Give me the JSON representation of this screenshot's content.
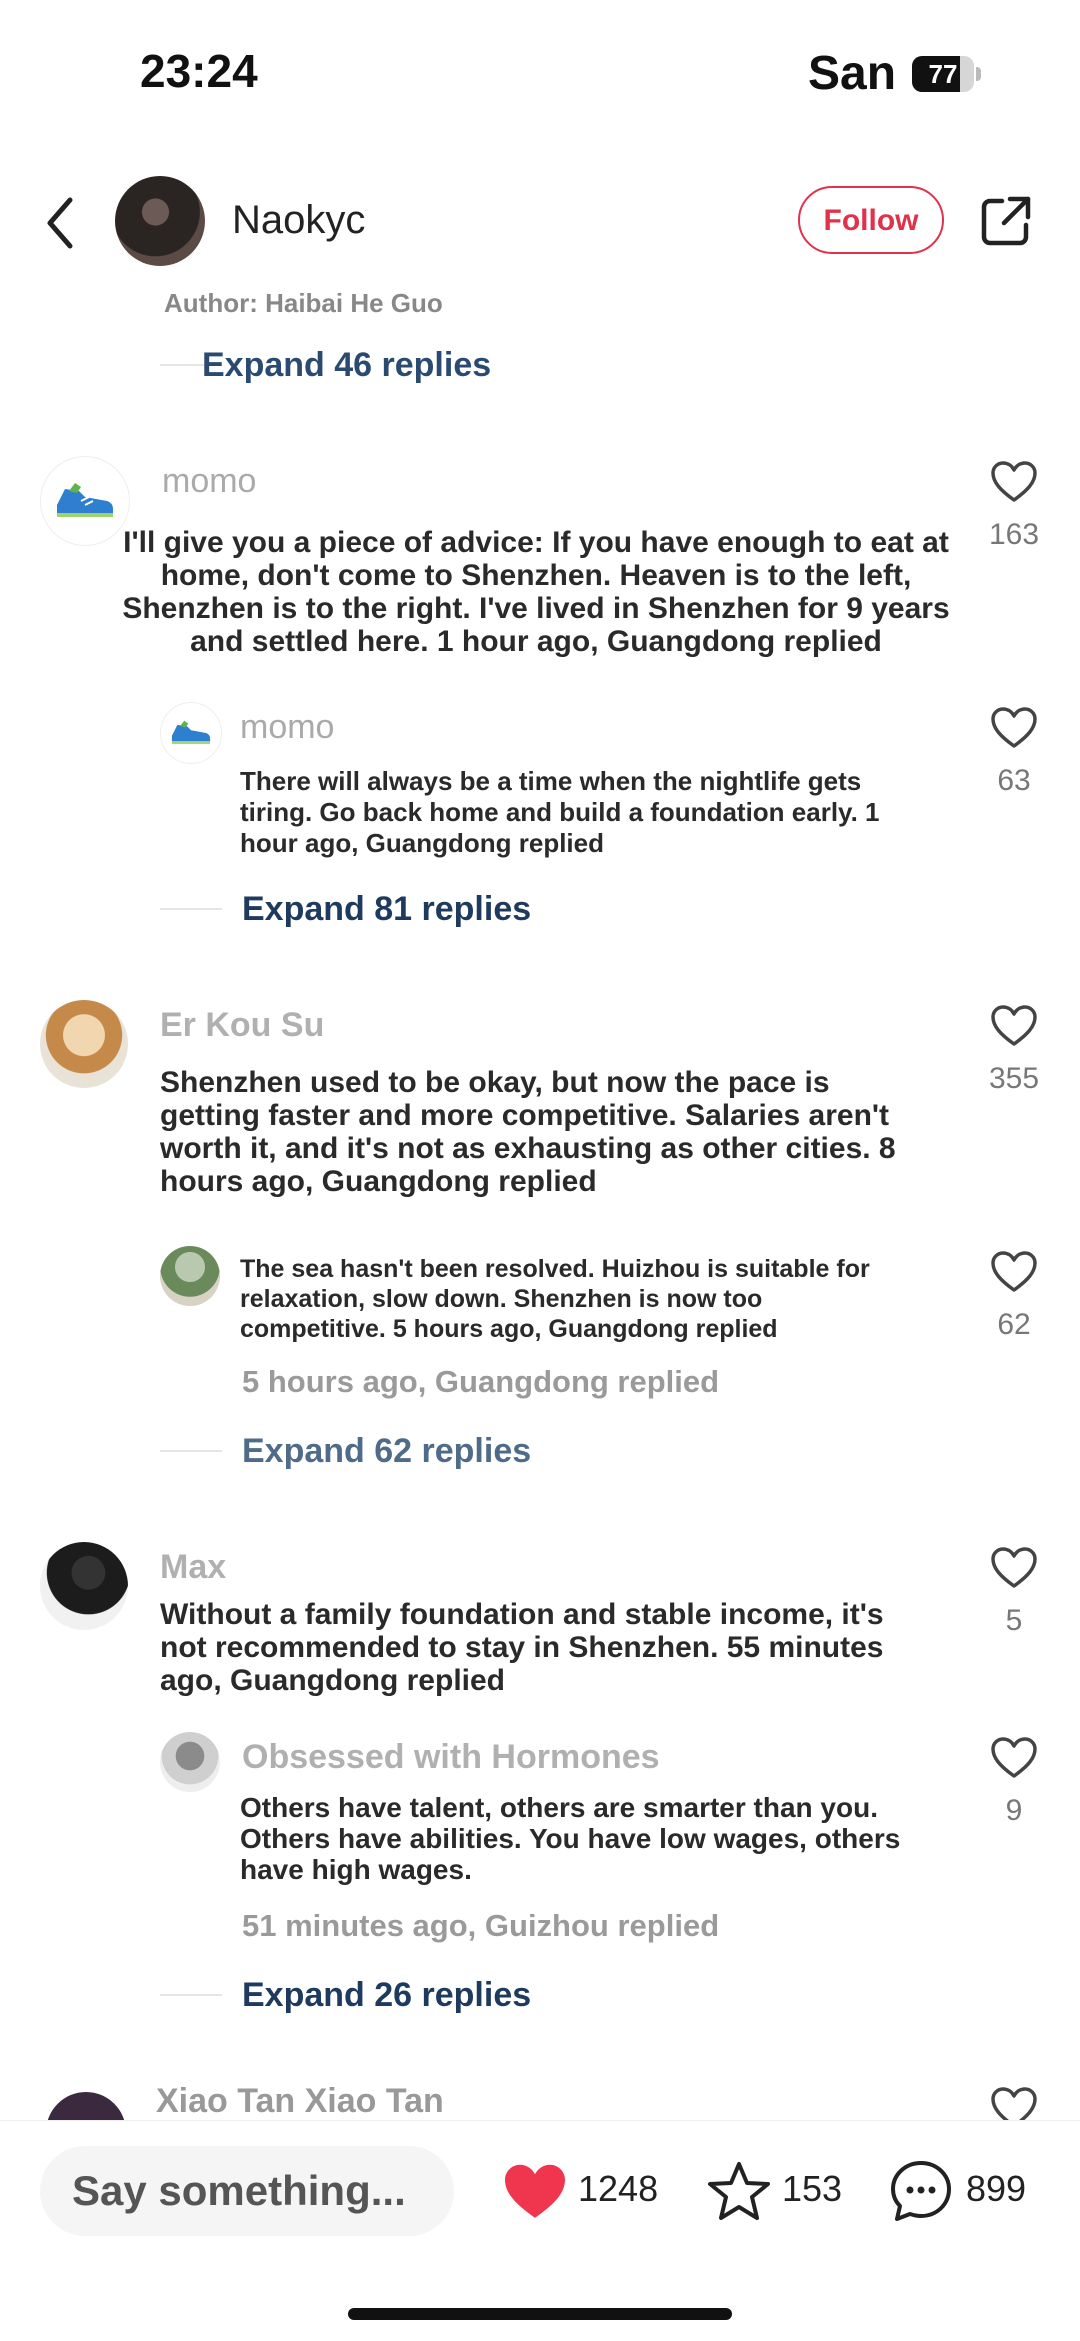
{
  "status": {
    "time": "23:24",
    "carrier": "San",
    "battery": "77",
    "battery_pct": 77
  },
  "header": {
    "author": "Naokyc",
    "follow_label": "Follow"
  },
  "thread_top": {
    "author_line": "Author: Haibai He Guo",
    "expand": "Expand 46 replies"
  },
  "comments": [
    {
      "name": "momo",
      "text": "I'll give you a piece of advice: If you have enough to eat at home, don't come to Shenzhen. Heaven is to the left, Shenzhen is to the right. I've lived in Shenzhen for 9 years and settled here. 1 hour ago, Guangdong replied",
      "likes": "163",
      "reply": {
        "name": "momo",
        "text": "There will always be a time when the nightlife gets tiring. Go back home and build a foundation early. 1 hour ago, Guangdong replied",
        "likes": "63"
      },
      "expand": "Expand 81 replies"
    },
    {
      "name": "Er Kou Su",
      "text": "Shenzhen used to be okay, but now the pace is getting faster and more competitive. Salaries aren't worth it, and it's not as exhausting as other cities. 8 hours ago, Guangdong replied",
      "likes": "355",
      "reply": {
        "text": "The sea hasn't been resolved. Huizhou is suitable for relaxation, slow down. Shenzhen is now too competitive. 5 hours ago, Guangdong replied",
        "likes": "62",
        "meta": "5 hours ago, Guangdong replied"
      },
      "expand": "Expand 62 replies"
    },
    {
      "name": "Max",
      "text": "Without a family foundation and stable income, it's not recommended to stay in Shenzhen. 55 minutes ago, Guangdong replied",
      "likes": "5",
      "reply": {
        "name": "Obsessed with Hormones",
        "text": "Others have talent, others are smarter than you. Others have abilities. You have low wages, others have high wages.",
        "likes": "9",
        "meta": "51 minutes ago, Guizhou replied"
      },
      "expand": "Expand 26 replies"
    },
    {
      "name": "Xiao Tan Xiao Tan"
    }
  ],
  "bottom_bar": {
    "placeholder": "Say something...",
    "likes": "1248",
    "stars": "153",
    "comments": "899"
  },
  "colors": {
    "accent": "#e0324b",
    "expand": "#2b4a72"
  }
}
